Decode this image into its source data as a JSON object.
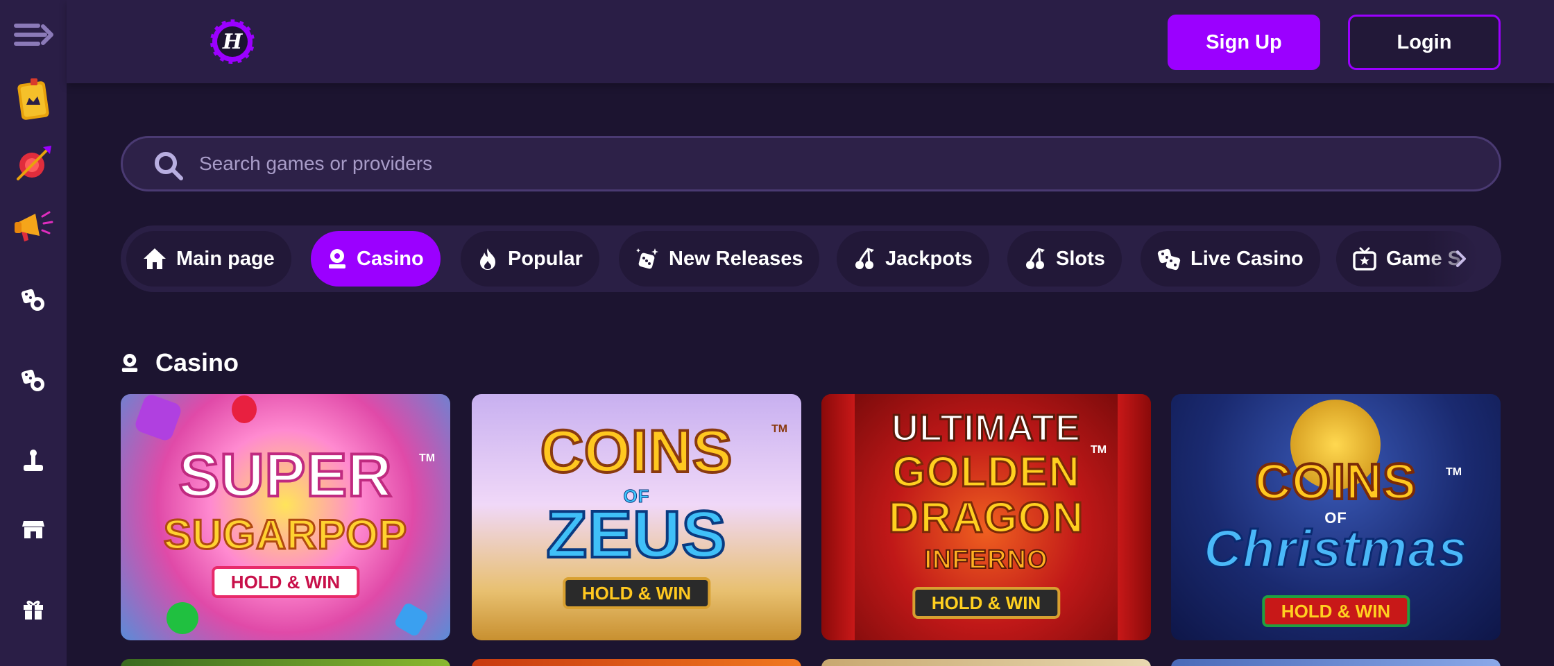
{
  "header": {
    "logo_letter": "H",
    "signup_label": "Sign Up",
    "login_label": "Login"
  },
  "sidebar": {
    "items": [
      {
        "icon": "menu-icon"
      },
      {
        "icon": "vip-badge-icon"
      },
      {
        "icon": "dart-target-icon"
      },
      {
        "icon": "megaphone-icon"
      },
      {
        "icon": "dice-chip-icon"
      },
      {
        "icon": "dice-chip-icon"
      },
      {
        "icon": "joystick-icon"
      },
      {
        "icon": "store-icon"
      },
      {
        "icon": "gift-icon"
      }
    ]
  },
  "search": {
    "placeholder": "Search games or providers"
  },
  "tabs": [
    {
      "label": "Main page",
      "icon": "home-icon",
      "active": false
    },
    {
      "label": "Casino",
      "icon": "casino-chip-icon",
      "active": true
    },
    {
      "label": "Popular",
      "icon": "flame-icon",
      "active": false
    },
    {
      "label": "New Releases",
      "icon": "dice-sparkle-icon",
      "active": false
    },
    {
      "label": "Jackpots",
      "icon": "cherry-icon",
      "active": false
    },
    {
      "label": "Slots",
      "icon": "cherry-icon",
      "active": false
    },
    {
      "label": "Live Casino",
      "icon": "dice-icon",
      "active": false
    },
    {
      "label": "Game S",
      "icon": "tv-star-icon",
      "active": false
    }
  ],
  "section": {
    "title": "Casino"
  },
  "games": [
    {
      "line1": "SUPER",
      "line2": "SUGARPOP",
      "line3": "",
      "badge": "HOLD & WIN",
      "tm": "TM"
    },
    {
      "line1": "COINS",
      "line2": "OF",
      "line3": "ZEUS",
      "badge": "HOLD & WIN",
      "tm": "TM"
    },
    {
      "line1": "ULTIMATE",
      "line2": "GOLDEN DRAGON",
      "line3": "INFERNO",
      "badge": "HOLD & WIN",
      "tm": "TM"
    },
    {
      "line1": "COINS",
      "line2": "OF",
      "line3": "Christmas",
      "badge": "HOLD & WIN",
      "tm": "TM"
    }
  ],
  "colors": {
    "accent": "#9b00ff",
    "background": "#1c1430",
    "panel": "#2a1e46"
  }
}
